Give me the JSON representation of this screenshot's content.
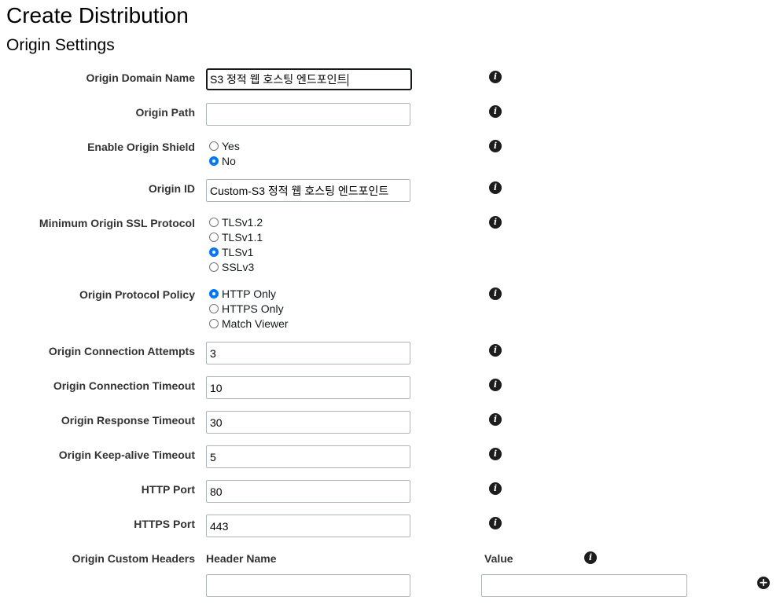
{
  "page_title": "Create Distribution",
  "section_title": "Origin Settings",
  "fields": {
    "origin_domain_name": {
      "label": "Origin Domain Name",
      "value": "S3 정적 웹 호스팅 엔드포인트"
    },
    "origin_path": {
      "label": "Origin Path",
      "value": ""
    },
    "enable_origin_shield": {
      "label": "Enable Origin Shield",
      "options": [
        "Yes",
        "No"
      ],
      "selected": "No"
    },
    "origin_id": {
      "label": "Origin ID",
      "value": "Custom-S3 정적 웹 호스팅 엔드포인트"
    },
    "min_ssl_protocol": {
      "label": "Minimum Origin SSL Protocol",
      "options": [
        "TLSv1.2",
        "TLSv1.1",
        "TLSv1",
        "SSLv3"
      ],
      "selected": "TLSv1"
    },
    "origin_protocol_policy": {
      "label": "Origin Protocol Policy",
      "options": [
        "HTTP Only",
        "HTTPS Only",
        "Match Viewer"
      ],
      "selected": "HTTP Only"
    },
    "connection_attempts": {
      "label": "Origin Connection Attempts",
      "value": "3"
    },
    "connection_timeout": {
      "label": "Origin Connection Timeout",
      "value": "10"
    },
    "response_timeout": {
      "label": "Origin Response Timeout",
      "value": "30"
    },
    "keepalive_timeout": {
      "label": "Origin Keep-alive Timeout",
      "value": "5"
    },
    "http_port": {
      "label": "HTTP Port",
      "value": "80"
    },
    "https_port": {
      "label": "HTTPS Port",
      "value": "443"
    },
    "custom_headers": {
      "label": "Origin Custom Headers",
      "header_name_label": "Header Name",
      "value_label": "Value",
      "header_name_value": "",
      "value_value": ""
    }
  },
  "icons": {
    "info": "info-icon",
    "add": "plus-circle-icon"
  },
  "colors": {
    "radio_checked": "#0075ff",
    "label_text": "#333333",
    "input_border": "#aab7b8"
  }
}
